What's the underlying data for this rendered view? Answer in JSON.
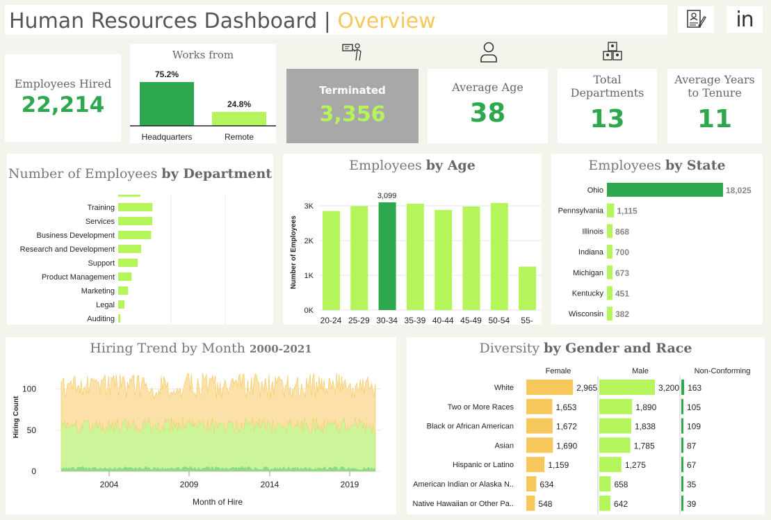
{
  "header": {
    "title": "Human Resources Dashboard",
    "separator": " | ",
    "subtitle": "Overview"
  },
  "icons": {
    "resume": "resume-icon",
    "linkedin": "linkedin-icon",
    "linkedin_text": "in",
    "terminated": "presentation-icon",
    "age": "person-icon",
    "departments": "departments-icon"
  },
  "kpis": {
    "hired_label": "Employees Hired",
    "hired_value": "22,214",
    "works_from_title": "Works from",
    "works_from": [
      {
        "label": "Headquarters",
        "pct": "75.2%",
        "value": 75.2
      },
      {
        "label": "Remote",
        "pct": "24.8%",
        "value": 24.8
      }
    ],
    "terminated_label": "Terminated",
    "terminated_value": "3,356",
    "avg_age_label": "Average Age",
    "avg_age_value": "38",
    "total_dept_label_1": "Total",
    "total_dept_label_2": "Departments",
    "total_dept_value": "13",
    "tenure_label_1": "Average Years",
    "tenure_label_2": "to Tenure",
    "tenure_value": "11"
  },
  "colors": {
    "dark_green": "#2ea84e",
    "light_green": "#b5f55c",
    "yellow": "#f6c75a",
    "gray": "#a8a8a8"
  },
  "chart_data": [
    {
      "type": "bar",
      "title_plain": "Number of Employees ",
      "title_bold": "by Department",
      "orientation": "horizontal",
      "categories": [
        "Training",
        "Services",
        "Business Development",
        "Research and Development",
        "Support",
        "Product Management",
        "Marketing",
        "Legal",
        "Auditing"
      ],
      "values": [
        1480,
        1470,
        1420,
        990,
        840,
        580,
        430,
        270,
        90
      ]
    },
    {
      "type": "bar",
      "title_plain": "Employees ",
      "title_bold": "by Age",
      "ylabel": "Number of Employees",
      "categories": [
        "20-24",
        "25-29",
        "30-34",
        "35-39",
        "40-44",
        "45-49",
        "50-54",
        "55-"
      ],
      "values": [
        2850,
        2990,
        3099,
        3060,
        2880,
        2980,
        3080,
        1250
      ],
      "highlight_index": 2,
      "highlight_label": "3,099",
      "yticks": [
        "0K",
        "1K",
        "2K",
        "3K"
      ],
      "ylim": [
        0,
        3300
      ]
    },
    {
      "type": "bar",
      "title_plain": "Employees ",
      "title_bold": "by State",
      "orientation": "horizontal",
      "categories": [
        "Ohio",
        "Pennsylvania",
        "Illinois",
        "Indiana",
        "Michigan",
        "Kentucky",
        "Wisconsin"
      ],
      "values": [
        18025,
        1115,
        868,
        700,
        673,
        451,
        382
      ],
      "value_labels": [
        "18,025",
        "1,115",
        "868",
        "700",
        "673",
        "451",
        "382"
      ]
    },
    {
      "type": "area",
      "title": "Hiring Trend by Month ",
      "title_suffix": "2000-2021",
      "xlabel": "Month of Hire",
      "ylabel": "Hiring Count",
      "xticks": [
        "2004",
        "2009",
        "2014",
        "2019"
      ],
      "yticks": [
        "0",
        "50",
        "100"
      ],
      "ylim": [
        0,
        125
      ],
      "series": [
        {
          "total_approx_range": [
            85,
            120
          ]
        },
        {
          "middle_approx_range": [
            45,
            65
          ]
        },
        {
          "bottom_approx_range": [
            2,
            6
          ]
        }
      ]
    },
    {
      "type": "bar",
      "title_plain": "Diversity ",
      "title_bold": "by Gender and Race",
      "orientation": "horizontal",
      "categories": [
        "White",
        "Two or More Races",
        "Black or African American",
        "Asian",
        "Hispanic or Latino",
        "American Indian or Alaska N..",
        "Native Hawaiian or Other Pa.."
      ],
      "series": [
        {
          "name": "Female",
          "values": [
            2965,
            1653,
            1672,
            1690,
            1159,
            634,
            548
          ],
          "labels": [
            "2,965",
            "1,653",
            "1,672",
            "1,690",
            "1,159",
            "634",
            "548"
          ]
        },
        {
          "name": "Male",
          "values": [
            3200,
            1890,
            1838,
            1785,
            1275,
            658,
            642
          ],
          "labels": [
            "3,200",
            "1,890",
            "1,838",
            "1,785",
            "1,275",
            "658",
            "642"
          ]
        },
        {
          "name": "Non-Conforming",
          "values": [
            163,
            105,
            109,
            87,
            67,
            35,
            39
          ],
          "labels": [
            "163",
            "105",
            "109",
            "87",
            "67",
            "35",
            "39"
          ]
        }
      ]
    }
  ]
}
